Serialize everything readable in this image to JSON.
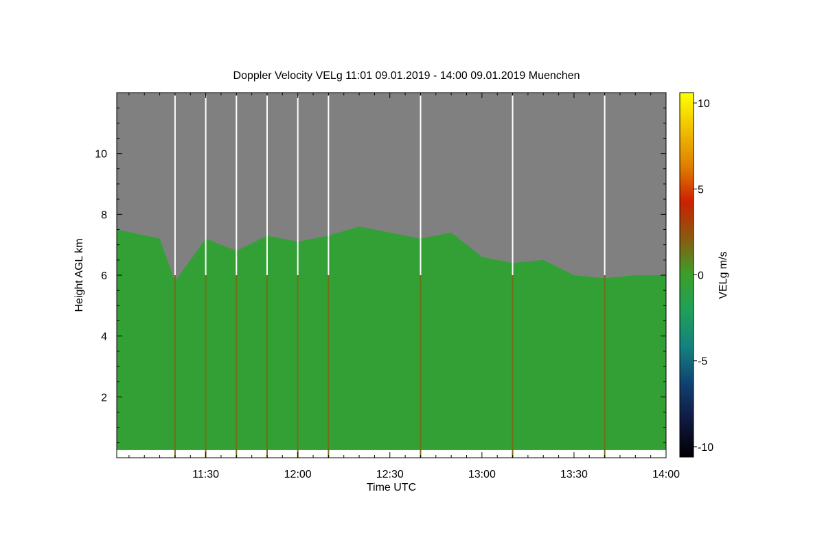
{
  "chart_data": {
    "type": "heatmap",
    "title": "Doppler Velocity VELg   11:01 09.01.2019 - 14:00 09.01.2019 Muenchen",
    "xlabel": "Time UTC",
    "ylabel": "Height AGL km",
    "x_range": [
      "11:01",
      "14:00"
    ],
    "x_ticks": [
      "11:30",
      "12:00",
      "12:30",
      "13:00",
      "13:30",
      "14:00"
    ],
    "ylim": [
      0,
      12
    ],
    "y_ticks": [
      2,
      4,
      6,
      8,
      10
    ],
    "colorbar": {
      "label": "VELg m/s",
      "range": [
        -10.6,
        10.6
      ],
      "ticks": [
        10,
        5,
        0,
        -5,
        -10
      ],
      "colors": [
        "#ffff00",
        "#f0c000",
        "#e08000",
        "#cc2000",
        "#8a5a10",
        "#3aa02a",
        "#1ea05a",
        "#148080",
        "#104070",
        "#101840",
        "#000000"
      ]
    },
    "no_data_color": "#808080",
    "background_velocity_ms": -0.5,
    "cloud_top_km": [
      {
        "time": "11:01",
        "height": 7.5
      },
      {
        "time": "11:15",
        "height": 7.2
      },
      {
        "time": "11:20",
        "height": 5.8
      },
      {
        "time": "11:30",
        "height": 7.2
      },
      {
        "time": "11:40",
        "height": 6.8
      },
      {
        "time": "11:50",
        "height": 7.3
      },
      {
        "time": "12:00",
        "height": 7.1
      },
      {
        "time": "12:10",
        "height": 7.3
      },
      {
        "time": "12:20",
        "height": 7.6
      },
      {
        "time": "12:30",
        "height": 7.4
      },
      {
        "time": "12:40",
        "height": 7.2
      },
      {
        "time": "12:50",
        "height": 7.4
      },
      {
        "time": "13:00",
        "height": 6.6
      },
      {
        "time": "13:10",
        "height": 6.4
      },
      {
        "time": "13:20",
        "height": 6.5
      },
      {
        "time": "13:30",
        "height": 6.0
      },
      {
        "time": "13:40",
        "height": 5.9
      },
      {
        "time": "13:50",
        "height": 6.0
      },
      {
        "time": "14:00",
        "height": 6.0
      }
    ],
    "vertical_scan_times": [
      "11:20",
      "11:30",
      "11:40",
      "11:50",
      "12:00",
      "12:10",
      "12:40",
      "13:10",
      "13:40"
    ]
  }
}
